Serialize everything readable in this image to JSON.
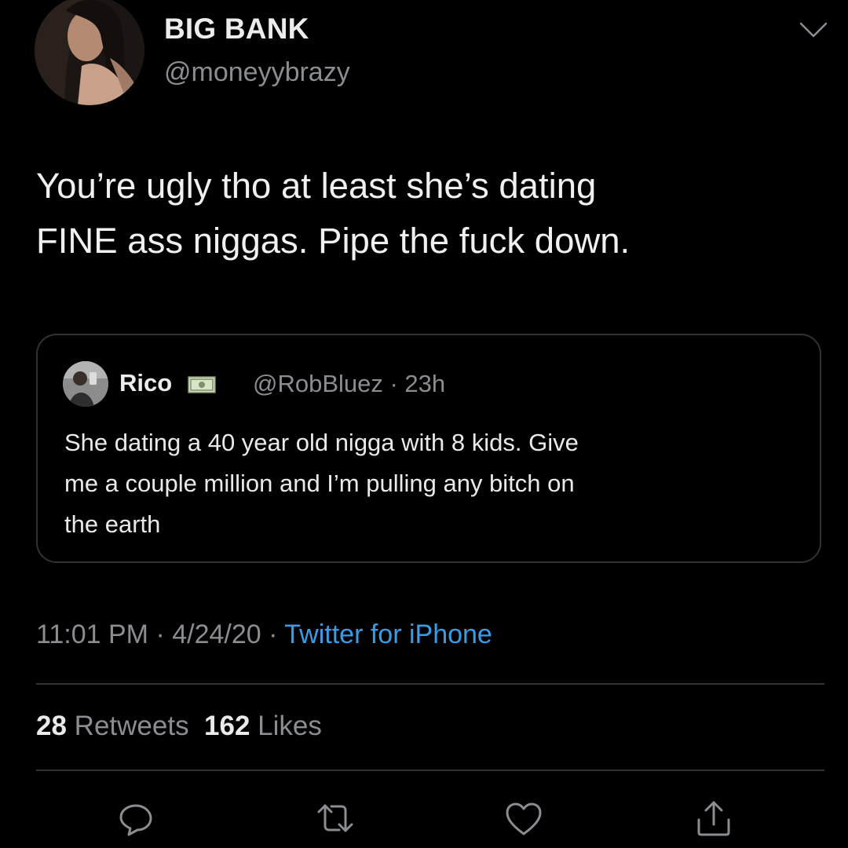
{
  "author": {
    "display_name": "BIG BANK",
    "handle": "@moneyybrazy"
  },
  "tweet": {
    "text_line1": "You’re ugly tho at least she’s dating",
    "text_line2": "FINE ass niggas. Pipe the fuck down."
  },
  "quoted_tweet": {
    "name": "Rico",
    "handle_time": "@RobBluez · 23h",
    "text_line1": "She dating a 40 year old nigga with 8 kids. Give",
    "text_line2": "me a couple million and I’m pulling any bitch on",
    "text_line3": "the earth"
  },
  "meta": {
    "time_date": "11:01 PM · 4/24/20 · ",
    "source": "Twitter for iPhone"
  },
  "stats": {
    "retweets_count": "28",
    "retweets_label": "Retweets",
    "likes_count": "162",
    "likes_label": "Likes"
  },
  "icons": {
    "caret": "chevron-down-icon",
    "reply": "reply-icon",
    "retweet": "retweet-icon",
    "like": "heart-icon",
    "share": "share-icon"
  },
  "colors": {
    "background": "#000000",
    "text": "#e7e9ea",
    "secondary": "#8a8d91",
    "link": "#3b9ce6",
    "border": "#2f3336"
  }
}
